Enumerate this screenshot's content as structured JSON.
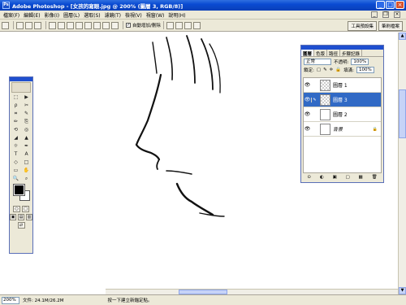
{
  "titlebar": {
    "title": "Adobe Photoshop - [女孩的寫眼.jpg @ 200% (圖層 3, RGB/8)]",
    "minimize": "_",
    "maximize": "□",
    "close": "×"
  },
  "menubar": {
    "items": [
      "檔案(F)",
      "編輯(E)",
      "影像(I)",
      "圖層(L)",
      "選取(S)",
      "濾鏡(T)",
      "檢視(V)",
      "視窗(W)",
      "說明(H)"
    ]
  },
  "optbar": {
    "auto_add_delete_label": "自動增加/刪除",
    "auto_add_delete_checked": "✓",
    "tool_presets_tab": "工具預設集",
    "brushes_tab": "筆刷檔案"
  },
  "toolbox": {
    "tools": [
      "⬚",
      "▶",
      "ρ",
      "✂",
      "⌗",
      "✎",
      "✏",
      "⎘",
      "⟲",
      "◎",
      "◢",
      "▲",
      "☼",
      "✒",
      "T",
      "A",
      "◇",
      "□",
      "▭",
      "✋",
      "🔍",
      "⌕"
    ],
    "fg_color": "#000000",
    "bg_color": "#ffffff",
    "mode_buttons": [
      "○",
      "□"
    ],
    "screen_buttons": [
      "▣",
      "▤",
      "▥"
    ]
  },
  "layers_panel": {
    "tabs": [
      "圖層",
      "色版",
      "路徑",
      "步驟記錄"
    ],
    "active_tab_index": 0,
    "blend_mode": "正常",
    "opacity_label": "不透明:",
    "opacity_value": "100%",
    "lock_label": "鎖定:",
    "fill_label": "填滿:",
    "fill_value": "100%",
    "layers": [
      {
        "name": "圖層 1",
        "visible": true,
        "selected": false
      },
      {
        "name": "圖層 3",
        "visible": true,
        "selected": true
      },
      {
        "name": "圖層 2",
        "visible": true,
        "selected": false
      },
      {
        "name": "背景",
        "visible": true,
        "selected": false,
        "locked": true
      }
    ],
    "footer_icons": [
      "⊙",
      "◐",
      "▣",
      "▢",
      "▦",
      "🗑"
    ]
  },
  "statusbar": {
    "zoom": "200%",
    "doc_info": "文件: 24.1M/26.2M",
    "hint": "按一下建立新錨定點。"
  }
}
